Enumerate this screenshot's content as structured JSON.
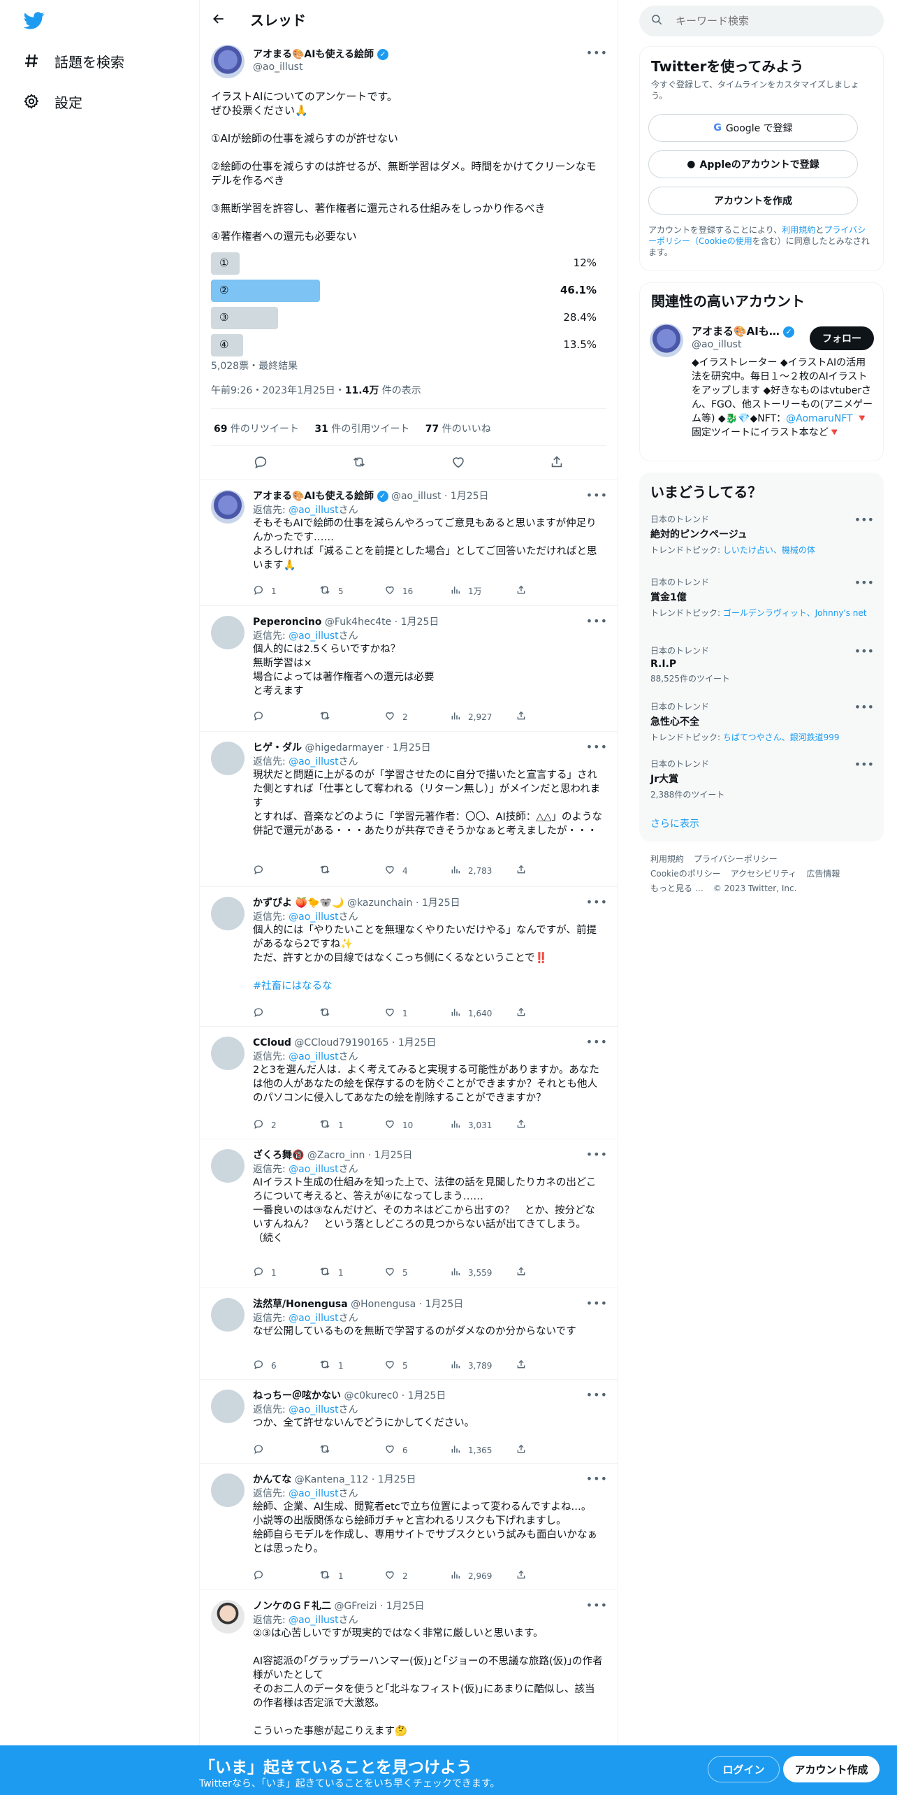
{
  "nav": {
    "explore_label": "話題を検索",
    "settings_label": "設定"
  },
  "header": {
    "title": "スレッド"
  },
  "focus_tweet": {
    "name": "アオまる🎨AIも使える絵師",
    "handle": "@ao_illust",
    "lines": [
      "イラストAIについてのアンケートです。",
      "ぜひ投票ください🙏",
      "",
      "①AIが絵師の仕事を減らすのが許せない",
      "",
      "②絵師の仕事を減らすのは許せるが、無断学習はダメ。時間をかけてクリーンなモデルを作るべき",
      "",
      "③無断学習を許容し、著作権者に還元される仕組みをしっかり作るべき",
      "",
      "④著作権者への還元も必要ない"
    ],
    "poll": [
      {
        "label": "①",
        "percent": 12,
        "percent_text": "12%",
        "winner": false
      },
      {
        "label": "②",
        "percent": 46.1,
        "percent_text": "46.1%",
        "winner": true
      },
      {
        "label": "③",
        "percent": 28.4,
        "percent_text": "28.4%",
        "winner": false
      },
      {
        "label": "④",
        "percent": 13.5,
        "percent_text": "13.5%",
        "winner": false
      }
    ],
    "poll_meta": "5,028票・最終結果",
    "time": "午前9:26・2023年1月25日・",
    "views_count": "11.4万",
    "views_suffix": " 件の表示",
    "retweets": "69",
    "retweets_label": " 件のリツイート",
    "quotes": "31",
    "quotes_label": " 件の引用ツイート",
    "likes": "77",
    "likes_label": " 件のいいね"
  },
  "replies": [
    {
      "name": "アオまる🎨AIも使える絵師",
      "handle": "@ao_illust",
      "date": "1月25日",
      "verified": true,
      "avatar": "blue",
      "reply_to": "@ao_illust",
      "reply_suffix": "さん",
      "text": "そもそもAIで絵師の仕事を減らんやろってご意見もあると思いますが仲足りんかったです……\nよろしければ「減ることを前提とした場合」としてご回答いただければと思います🙏",
      "counts": [
        "1",
        "5",
        "16",
        "1万"
      ]
    },
    {
      "name": "Peperoncino",
      "handle": "@Fuk4hec4te",
      "date": "1月25日",
      "verified": false,
      "avatar": "gray",
      "reply_to": "@ao_illust",
      "reply_suffix": "さん",
      "text": "個人的には2.5くらいですかね？\n無断学習は×\n場合によっては著作権者への還元は必要\nと考えます",
      "counts": [
        "",
        "",
        "2",
        "2,927"
      ]
    },
    {
      "name": "ヒゲ・ダル",
      "handle": "@higedarmayer",
      "date": "1月25日",
      "verified": false,
      "avatar": "gray",
      "reply_to": "@ao_illust",
      "reply_suffix": "さん",
      "text": "現状だと問題に上がるのが「学習させたのに自分で描いたと宣言する」された側とすれば「仕事として奪われる（リターン無し）」がメインだと思われます\nとすれば、音楽などのように「学習元著作者：〇〇、AI技師：△△」のような併記で還元がある・・・あたりが共存できそうかなぁと考えましたが・・・",
      "counts": [
        "",
        "",
        "4",
        "2,783"
      ]
    },
    {
      "name": "かずぴよ 🍑🐤🐨🌙",
      "handle": "@kazunchain",
      "date": "1月25日",
      "verified": false,
      "avatar": "gray",
      "reply_to": "@ao_illust",
      "reply_suffix": "さん",
      "text": "個人的には「やりたいことを無理なくやりたいだけやる」なんですが、前提があるなら2ですね✨\nただ、許すとかの目線ではなくこっち側にくるなということで‼️\n\n",
      "hashtag": "#社畜にはなるな",
      "counts": [
        "",
        "",
        "1",
        "1,640"
      ]
    },
    {
      "name": "CCloud",
      "handle": "@CCloud79190165",
      "date": "1月25日",
      "verified": false,
      "avatar": "gray",
      "reply_to": "@ao_illust",
      "reply_suffix": "さん",
      "text": "2と3を選んだ人は．よく考えてみると実現する可能性がありますか。あなたは他の人があなたの絵を保存するのを防ぐことができますか？それとも他人のパソコンに侵入してあなたの絵を削除することができますか？",
      "counts": [
        "2",
        "1",
        "10",
        "3,031"
      ]
    },
    {
      "name": "ざくろ舞🔞",
      "handle": "@Zacro_inn",
      "date": "1月25日",
      "verified": false,
      "avatar": "gray",
      "reply_to": "@ao_illust",
      "reply_suffix": "さん",
      "text": "AIイラスト生成の仕組みを知った上で、法律の話を見聞したりカネの出どころについて考えると、答えが④になってしまう……\n一番良いのは③なんだけど、そのカネはどこから出すの？　とか、按分どないすんねん？　という落としどころの見つからない話が出てきてしまう。\n（続く",
      "counts": [
        "1",
        "1",
        "5",
        "3,559"
      ]
    },
    {
      "name": "法然草/Honengusa",
      "handle": "@Honengusa",
      "date": "1月25日",
      "verified": false,
      "avatar": "gray",
      "reply_to": "@ao_illust",
      "reply_suffix": "さん",
      "text": "なぜ公開しているものを無断で学習するのがダメなのか分からないです",
      "counts": [
        "6",
        "1",
        "5",
        "3,789"
      ]
    },
    {
      "name": "ねっちー＠呟かない",
      "handle": "@c0kurec0",
      "date": "1月25日",
      "verified": false,
      "avatar": "gray",
      "reply_to": "@ao_illust",
      "reply_suffix": "さん",
      "text": "つか、全て許せないんでどうにかしてください。",
      "counts": [
        "",
        "",
        "6",
        "1,365"
      ]
    },
    {
      "name": "かんてな",
      "handle": "@Kantena_112",
      "date": "1月25日",
      "verified": false,
      "avatar": "gray",
      "reply_to": "@ao_illust",
      "reply_suffix": "さん",
      "text": "絵師、企業、AI生成、閲覧者etcで立ち位置によって変わるんですよね…。\n小説等の出版関係なら絵師ガチャと言われるリスクも下げれますし。\n絵師自らモデルを作成し、専用サイトでサブスクという試みも面白いかなぁとは思ったり。",
      "counts": [
        "",
        "1",
        "2",
        "2,969"
      ]
    },
    {
      "name": "ノンケのＧＦ礼二",
      "handle": "@GFreizi",
      "date": "1月25日",
      "verified": false,
      "avatar": "face",
      "reply_to": "@ao_illust",
      "reply_suffix": "さん",
      "text": "②③は心苦しいですが現実的ではなく非常に厳しいと思います。\n\nAI容認派の｢グラップラーハンマー(仮)｣と｢ジョーの不思議な旅路(仮)｣の作者様がいたとして\nそのお二人のデータを使うと｢北斗なフィスト(仮)｣にあまりに酷似し、該当の作者様は否定派で大激怒。\n\nこういった事態が起こりえます🤔",
      "counts": [
        "",
        "",
        "",
        ""
      ]
    }
  ],
  "search": {
    "placeholder": "キーワード検索"
  },
  "signup_card": {
    "title": "Twitterを使ってみよう",
    "desc": "今すぐ登録して、タイムラインをカスタマイズしましょう。",
    "google": "Google で登録",
    "apple": "Appleのアカウントで登録",
    "create": "アカウントを作成",
    "terms_pre": "アカウントを登録することにより、",
    "terms_link1": "利用規約",
    "terms_mid": "と",
    "terms_link2": "プライバシーポリシー（Cookieの使用",
    "terms_post": "を含む）に同意したとみなされます。"
  },
  "related": {
    "title": "関連性の高いアカウント",
    "name": "アオまる🎨AIも…",
    "handle": "@ao_illust",
    "follow": "フォロー",
    "bio": "◆イラストレーター ◆イラストAIの活用法を研究中。毎日１～２枚のAIイラストをアップします ◆好きなものはvtuberさん、FGO、他ストーリーもの(アニメゲーム等) ◆🐉💎◆NFT：",
    "bio_link": "@AomaruNFT",
    "bio_end": " 🔻固定ツイートにイラスト本など🔻"
  },
  "trends": {
    "title": "いまどうしてる？",
    "items": [
      {
        "cat": "日本のトレンド",
        "title": "絶対的ピンクページュ",
        "sub_pre": "トレンドトピック: ",
        "sub_link": "しいたけ占い、機械の体"
      },
      {
        "cat": "日本のトレンド",
        "title": "賞金1億",
        "sub_pre": "トレンドトピック: ",
        "sub_link": "ゴールデンラヴィット、Johnny's net"
      },
      {
        "cat": "日本のトレンド",
        "title": "R.I.P",
        "sub_pre": "88,525件のツイート",
        "sub_link": ""
      },
      {
        "cat": "日本のトレンド",
        "title": "急性心不全",
        "sub_pre": "トレンドトピック: ",
        "sub_link": "ちばてつやさん、銀河鉄道999"
      },
      {
        "cat": "日本のトレンド",
        "title": "Jr大賞",
        "sub_pre": "2,388件のツイート",
        "sub_link": ""
      }
    ],
    "more": "さらに表示"
  },
  "footer": {
    "l1": "利用規約",
    "l2": "プライバシーポリシー",
    "l3": "Cookieのポリシー",
    "l4": "アクセシビリティ",
    "l5": "広告情報",
    "l6": "もっと見る …",
    "l7": "© 2023 Twitter, Inc."
  },
  "bottom_bar": {
    "title": "「いま」起きていることを見つけよう",
    "sub": "Twitterなら、「いま」起きていることをいち早くチェックできます。",
    "login": "ログイン",
    "signup": "アカウント作成"
  },
  "colors": {
    "accent": "#1d9bf0",
    "poll_win": "#7dc3f3",
    "poll_bar": "#cfd9de"
  }
}
